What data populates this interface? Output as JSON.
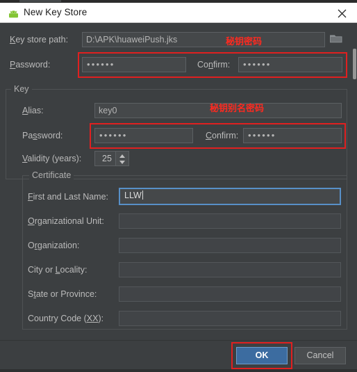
{
  "window": {
    "title": "New Key Store",
    "app_icon": "android-robot-icon",
    "close_icon": "close-icon"
  },
  "keystore": {
    "path_label": "Key store path:",
    "path_label_mnemonic": "K",
    "path_value": "D:\\APK\\huaweiPush.jks",
    "browse_icon": "folder-icon",
    "password_label": "Password:",
    "password_label_mnemonic": "P",
    "password_value": "••••••",
    "confirm_label": "Confirm:",
    "confirm_label_mnemonic": "n",
    "confirm_value": "••••••",
    "annotation": "秘钥密码"
  },
  "key_group": {
    "title": "Key",
    "alias_label": "Alias:",
    "alias_label_mnemonic": "A",
    "alias_value": "key0",
    "password_label": "Password:",
    "password_label_mnemonic": "s",
    "password_value": "••••••",
    "confirm_label": "Confirm:",
    "confirm_label_mnemonic": "C",
    "confirm_value": "••••••",
    "validity_label": "Validity (years):",
    "validity_label_mnemonic": "V",
    "validity_value": "25",
    "annotation": "秘钥别名密码"
  },
  "certificate": {
    "title": "Certificate",
    "fields": [
      {
        "label": "First and Last Name:",
        "mnemonic": "F",
        "value": "LLW",
        "focused": true
      },
      {
        "label": "Organizational Unit:",
        "mnemonic": "O",
        "value": "",
        "focused": false
      },
      {
        "label": "Organization:",
        "mnemonic": "r",
        "value": "",
        "focused": false
      },
      {
        "label": "City or Locality:",
        "mnemonic": "L",
        "value": "",
        "focused": false
      },
      {
        "label": "State or Province:",
        "mnemonic": "t",
        "value": "",
        "focused": false
      },
      {
        "label": "Country Code (XX):",
        "mnemonic": "XX",
        "value": "",
        "focused": false
      }
    ]
  },
  "footer": {
    "ok_label": "OK",
    "cancel_label": "Cancel"
  },
  "colors": {
    "dialog_bg": "#3c3f41",
    "titlebar_bg": "#ffffff",
    "field_bg": "#45484a",
    "accent_blue": "#3c6ca0",
    "focus_border": "#5890c8",
    "annotation_red": "#ff2a20",
    "highlight_red": "#e02020",
    "android_green": "#83c534"
  }
}
